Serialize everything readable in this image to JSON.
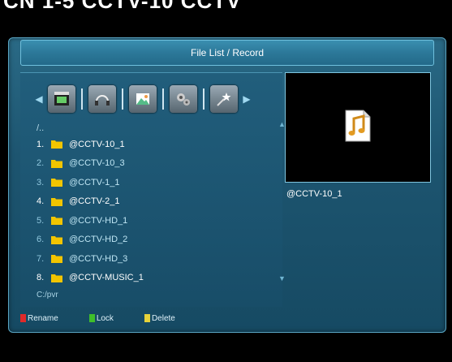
{
  "window": {
    "title": "File List / Record"
  },
  "top_banner": "CN 1-5 CCTV-10 CCTV",
  "categories": [
    {
      "name": "movie-icon"
    },
    {
      "name": "music-icon"
    },
    {
      "name": "image-icon"
    },
    {
      "name": "settings-icon"
    },
    {
      "name": "effects-icon"
    }
  ],
  "file_list": {
    "parent": "/..",
    "items": [
      {
        "index": "1.",
        "name": "@CCTV-10_1"
      },
      {
        "index": "2.",
        "name": "@CCTV-10_3"
      },
      {
        "index": "3.",
        "name": "@CCTV-1_1"
      },
      {
        "index": "4.",
        "name": "@CCTV-2_1"
      },
      {
        "index": "5.",
        "name": "@CCTV-HD_1"
      },
      {
        "index": "6.",
        "name": "@CCTV-HD_2"
      },
      {
        "index": "7.",
        "name": "@CCTV-HD_3"
      },
      {
        "index": "8.",
        "name": "@CCTV-MUSIC_1"
      }
    ],
    "current_path": "C:/pvr"
  },
  "preview": {
    "name": "@CCTV-10_1",
    "icon": "music-file-icon"
  },
  "legend": [
    {
      "label": "Rename",
      "color": "#e02a2a"
    },
    {
      "label": "Lock",
      "color": "#3fbf2a"
    },
    {
      "label": "Delete",
      "color": "#e6d23a"
    }
  ]
}
